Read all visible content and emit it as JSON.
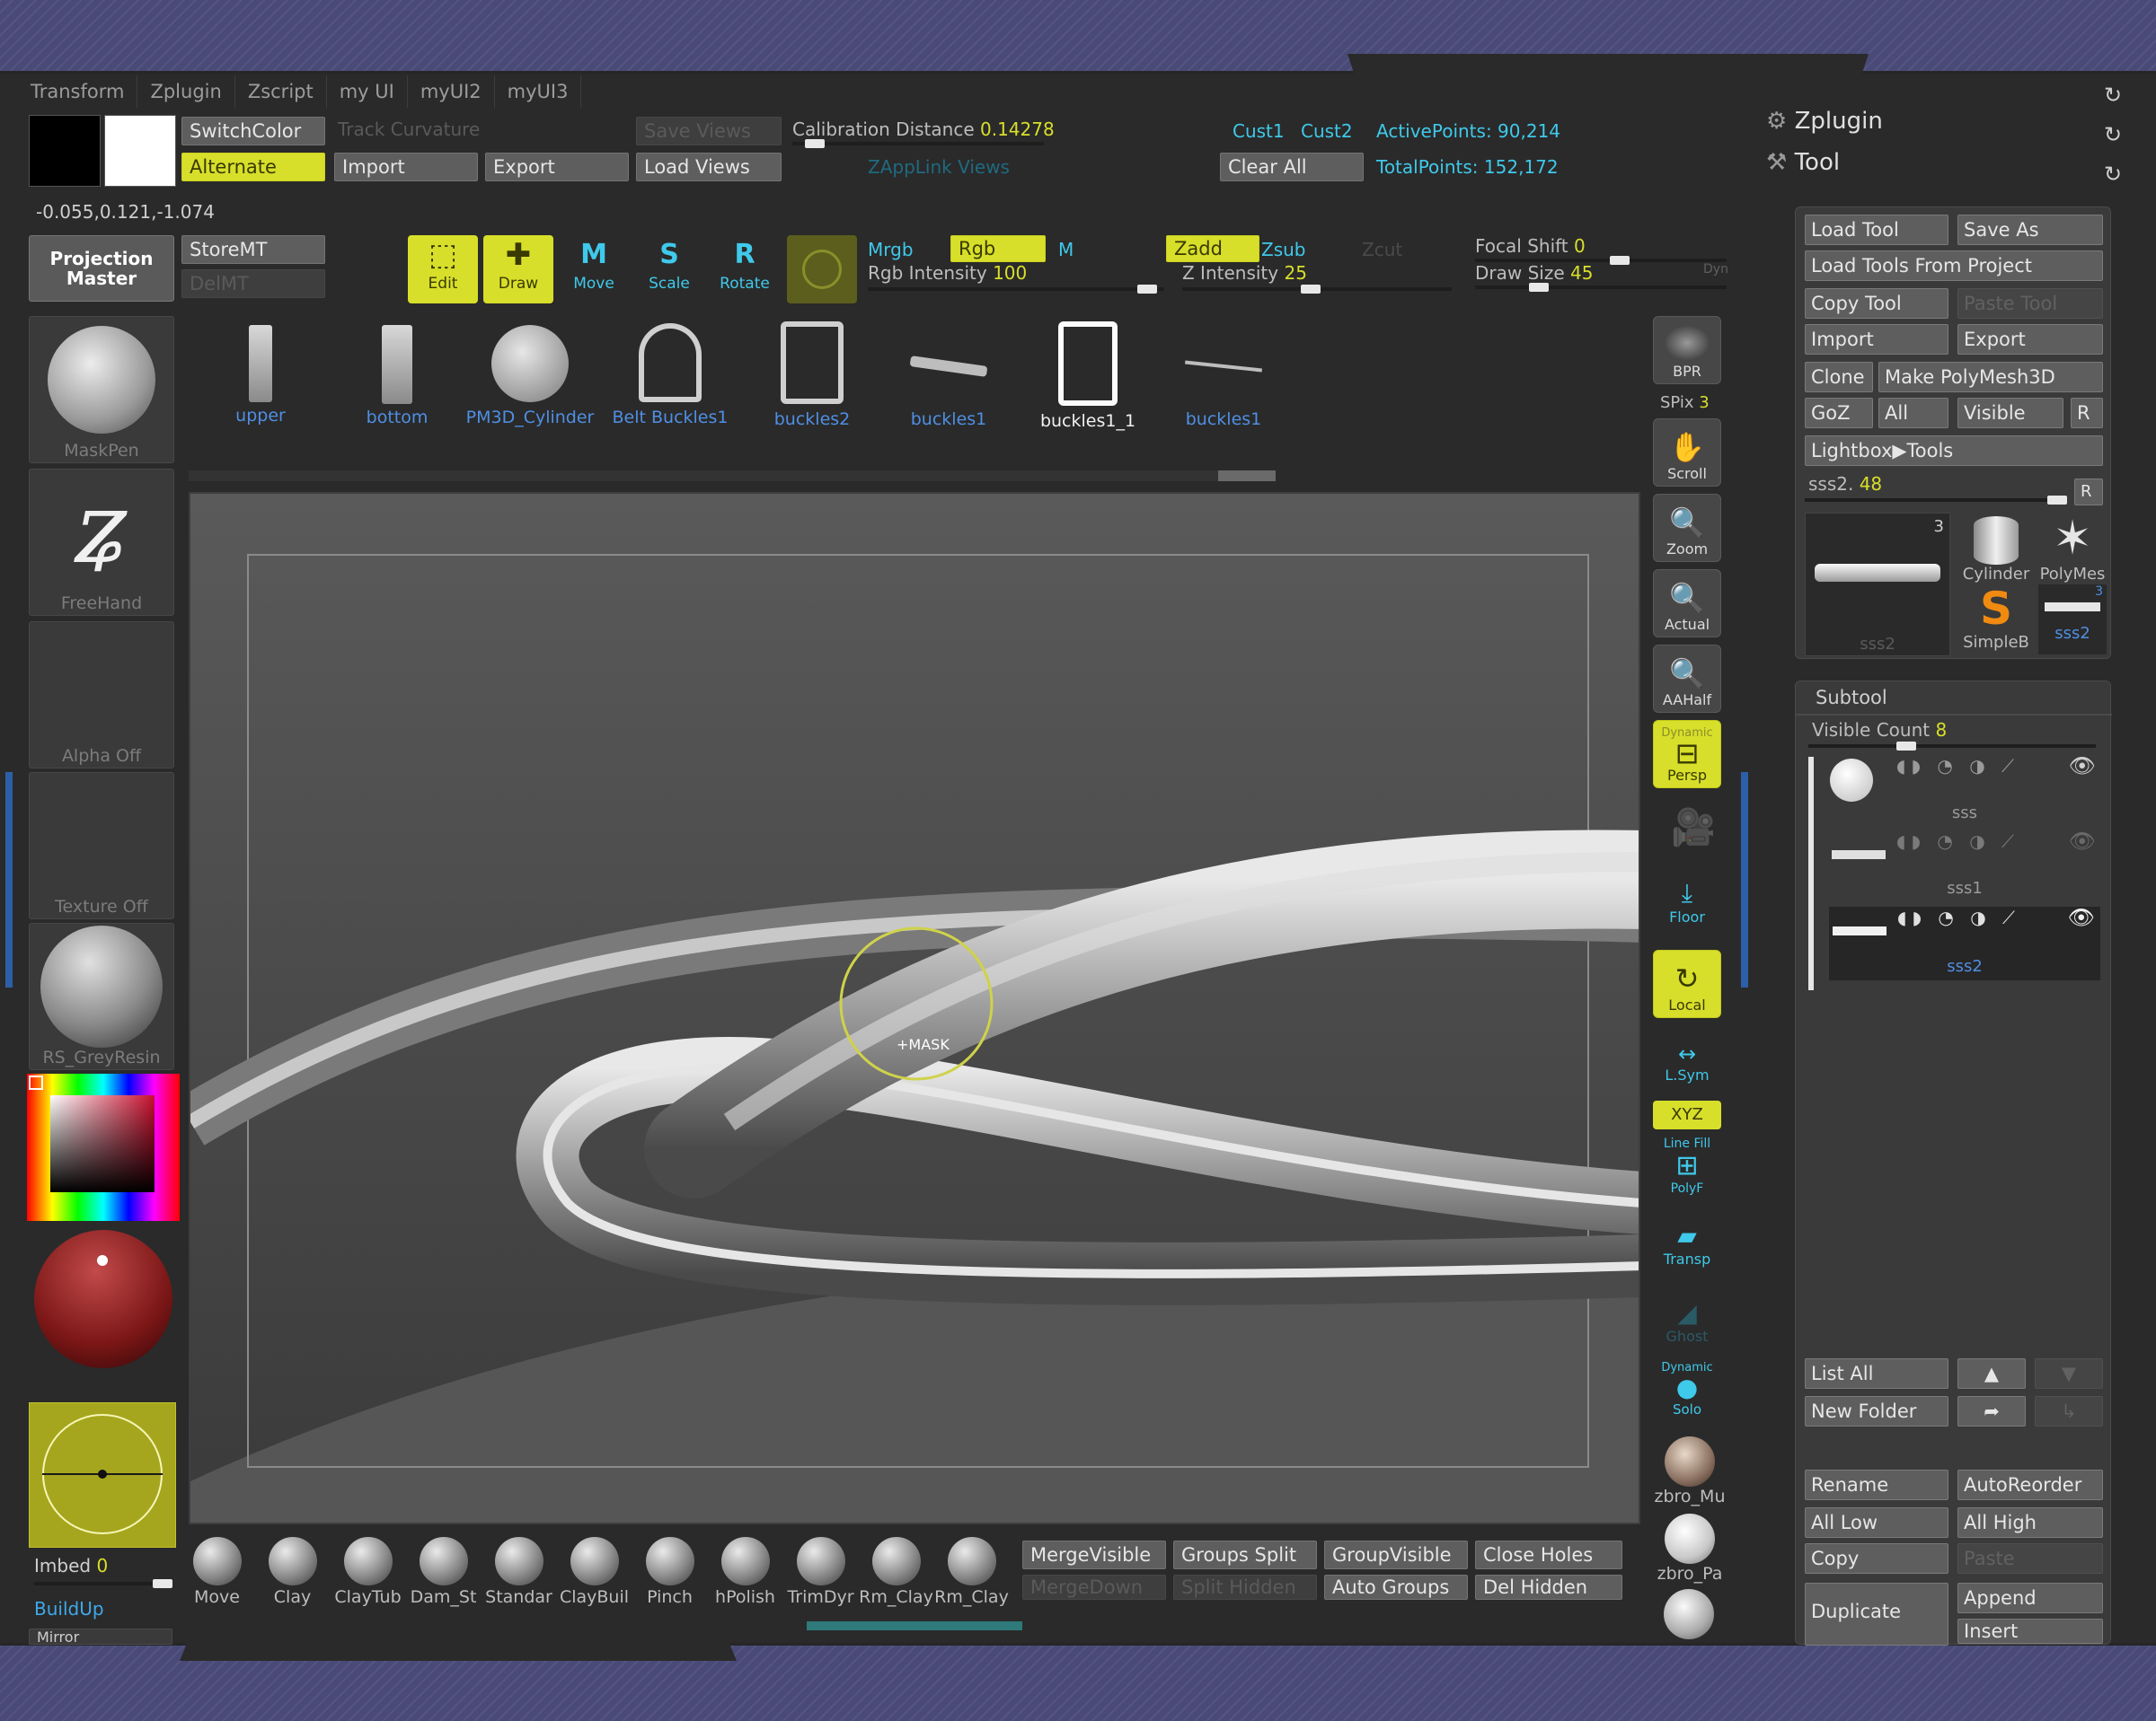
{
  "menu": [
    "Transform",
    "Zplugin",
    "Zscript",
    "my UI",
    "myUI2",
    "myUI3"
  ],
  "coords": "-0.055,0.121,-1.074",
  "top": {
    "switch_color": "SwitchColor",
    "alternate": "Alternate",
    "track_curvature": "Track Curvature",
    "import": "Import",
    "export": "Export",
    "save_views": "Save Views",
    "load_views": "Load Views",
    "calibration_label": "Calibration Distance",
    "calibration_value": "0.14278",
    "zapplink": "ZAppLink Views",
    "cust1": "Cust1",
    "cust2": "Cust2",
    "clear_all": "Clear All",
    "active_points_label": "ActivePoints:",
    "active_points": "90,214",
    "total_points_label": "TotalPoints:",
    "total_points": "152,172"
  },
  "second": {
    "projection_master": "Projection Master",
    "store_mt": "StoreMT",
    "del_mt": "DelMT",
    "modes": [
      {
        "key": "edit",
        "label": "Edit"
      },
      {
        "key": "draw",
        "label": "Draw"
      },
      {
        "key": "move",
        "label": "Move"
      },
      {
        "key": "scale",
        "label": "Scale"
      },
      {
        "key": "rotate",
        "label": "Rotate"
      }
    ],
    "mrgb": "Mrgb",
    "rgb": "Rgb",
    "m": "M",
    "rgb_intensity_label": "Rgb Intensity",
    "rgb_intensity": "100",
    "zadd": "Zadd",
    "zsub": "Zsub",
    "zcut": "Zcut",
    "z_intensity_label": "Z Intensity",
    "z_intensity": "25",
    "focal_shift_label": "Focal Shift",
    "focal_shift": "0",
    "draw_size_label": "Draw Size",
    "draw_size": "45",
    "dyn": "Dyn"
  },
  "left": {
    "maskpen": "MaskPen",
    "freehand": "FreeHand",
    "alpha": "Alpha Off",
    "texture": "Texture Off",
    "material": "RS_GreyResin",
    "imbed_label": "Imbed",
    "imbed": "0",
    "buildup": "BuildUp",
    "mirror": "Mirror"
  },
  "tools": [
    {
      "label": "upper",
      "active": false
    },
    {
      "label": "bottom",
      "active": false
    },
    {
      "label": "PM3D_Cylinder",
      "active": false
    },
    {
      "label": "Belt Buckles1",
      "active": false
    },
    {
      "label": "buckles2",
      "active": false
    },
    {
      "label": "buckles1",
      "active": false
    },
    {
      "label": "buckles1_1",
      "active": true
    },
    {
      "label": "buckles1",
      "active": false
    }
  ],
  "canvas": {
    "cursor_label": "+MASK"
  },
  "right_shelf": {
    "bpr": "BPR",
    "spix_label": "SPix",
    "spix": "3",
    "scroll": "Scroll",
    "zoom": "Zoom",
    "actual": "Actual",
    "aahalf": "AAHalf",
    "dynamic": "Dynamic",
    "persp": "Persp",
    "floor": "Floor",
    "local": "Local",
    "lsym": "L.Sym",
    "xyz": "XYZ",
    "line_fill": "Line Fill",
    "polyf": "PolyF",
    "transp": "Transp",
    "ghost": "Ghost",
    "dynamic2": "Dynamic",
    "solo": "Solo",
    "zbro_mu": "zbro_Mu",
    "zbro_pa": "zbro_Pa"
  },
  "palette": {
    "zplugin": "Zplugin",
    "tool": "Tool",
    "load_tool": "Load Tool",
    "save_as": "Save As",
    "load_from_project": "Load Tools From Project",
    "copy_tool": "Copy Tool",
    "paste_tool": "Paste Tool",
    "import": "Import",
    "export": "Export",
    "clone": "Clone",
    "make_polymesh": "Make PolyMesh3D",
    "goz": "GoZ",
    "all": "All",
    "visible": "Visible",
    "r": "R",
    "lightbox": "Lightbox▶Tools",
    "sss2_label": "sss2.",
    "sss2_val": "48",
    "thumb_count": "3",
    "cylinder": "Cylinder",
    "polymesh": "PolyMes",
    "simpleb": "SimpleB",
    "sss2": "sss2",
    "thumb_small_count": "3",
    "subtool": "Subtool",
    "visible_count_label": "Visible Count",
    "visible_count": "8",
    "subtools": [
      {
        "name": "sss"
      },
      {
        "name": "sss1"
      },
      {
        "name": "sss2"
      }
    ],
    "list_all": "List All",
    "new_folder": "New Folder",
    "rename": "Rename",
    "auto_reorder": "AutoReorder",
    "all_low": "All Low",
    "all_high": "All High",
    "copy": "Copy",
    "paste": "Paste",
    "duplicate": "Duplicate",
    "append": "Append",
    "insert": "Insert"
  },
  "bottom": {
    "brushes": [
      "Move",
      "Clay",
      "ClayTub",
      "Dam_St",
      "Standar",
      "ClayBuil",
      "Pinch",
      "hPolish",
      "TrimDyr",
      "Rm_Clay",
      "Rm_Clay"
    ],
    "merge_visible": "MergeVisible",
    "merge_down": "MergeDown",
    "groups_split": "Groups Split",
    "split_hidden": "Split Hidden",
    "group_visible": "GroupVisible",
    "auto_groups": "Auto Groups",
    "close_holes": "Close Holes",
    "del_hidden": "Del Hidden"
  },
  "colors": {
    "accent_yellow": "#d7df2a",
    "frame": "#4a4a78",
    "link_blue": "#4f8fe3",
    "cyan": "#3fc9ea"
  }
}
